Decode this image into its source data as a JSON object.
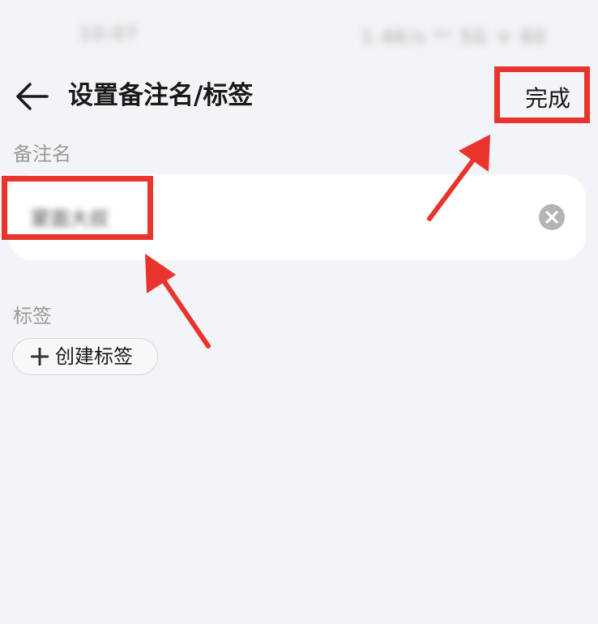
{
  "status_bar": {
    "time": "10:07",
    "indicators": "1.4K/s ⁴ᴳ 5G ᯤ 60"
  },
  "header": {
    "back_icon": "arrow-left-icon",
    "title": "设置备注名/标签",
    "done_label": "完成"
  },
  "remark": {
    "section_label": "备注名",
    "value": "蒙面大叔",
    "clear_icon": "clear-circle-icon"
  },
  "tags": {
    "section_label": "标签",
    "create_label": "创建标签",
    "create_icon": "plus-icon"
  },
  "colors": {
    "background": "#f2f4f7",
    "annotation_red": "#e8342c",
    "field_background": "#ffffff",
    "secondary_text": "#9a9a9a"
  }
}
